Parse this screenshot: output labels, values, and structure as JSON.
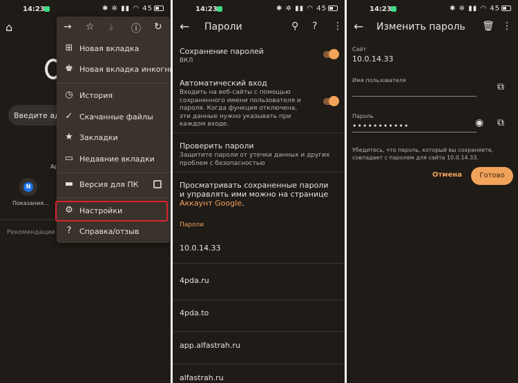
{
  "status": {
    "time": "14:23",
    "battery": "45"
  },
  "browser": {
    "search_placeholder": "Введите адрес",
    "shortcut_label_partial": "Ap",
    "shortcut_letter": "N",
    "shortcut_label": "Показания...",
    "recommendations": "Рекомендации от Google"
  },
  "menu": {
    "items": [
      {
        "label": "Новая вкладка",
        "icon": "plus-box-icon"
      },
      {
        "label": "Новая вкладка инкогнито",
        "icon": "incognito-icon"
      },
      {
        "label": "История",
        "icon": "history-icon"
      },
      {
        "label": "Скачанные файлы",
        "icon": "download-done-icon"
      },
      {
        "label": "Закладки",
        "icon": "star-icon"
      },
      {
        "label": "Недавние вкладки",
        "icon": "devices-icon"
      },
      {
        "label": "Версия для ПК",
        "icon": "monitor-icon"
      },
      {
        "label": "Настройки",
        "icon": "gear-icon"
      },
      {
        "label": "Справка/отзыв",
        "icon": "help-icon"
      }
    ],
    "highlight_color": "#d9232d"
  },
  "passwords": {
    "title": "Пароли",
    "save_title": "Сохранение паролей",
    "save_state": "ВКЛ",
    "autologin_title": "Автоматический вход",
    "autologin_desc": "Входить на веб-сайты с помощью сохраненного имени пользователя и пароля. Когда функция отключена, эти данные нужно указывать при каждом входе.",
    "check_title": "Проверить пароли",
    "check_desc": "Защитите пароли от утечки данных и других проблем с безопасностью",
    "browse_text": "Просматривать сохраненные пароли и управлять ими можно на странице ",
    "browse_link": "Аккаунт Google",
    "browse_end": ".",
    "section": "Пароли",
    "sites": [
      "10.0.14.33",
      "4pda.ru",
      "4pda.to",
      "app.alfastrah.ru",
      "alfastrah.ru"
    ]
  },
  "edit": {
    "title": "Изменить пароль",
    "site_label": "Сайт",
    "site_value": "10.0.14.33",
    "user_label": "Имя пользователя",
    "user_value": "",
    "pass_label": "Пароль",
    "pass_value": "•••••••••••",
    "note": "Убедитесь, что пароль, который вы сохраняете, совпадает с паролем для сайта 10.0.14.33.",
    "cancel": "Отмена",
    "done": "Готово"
  },
  "colors": {
    "background": "#1f1b17",
    "accent": "#f2a35a",
    "menu": "#3a332c"
  }
}
